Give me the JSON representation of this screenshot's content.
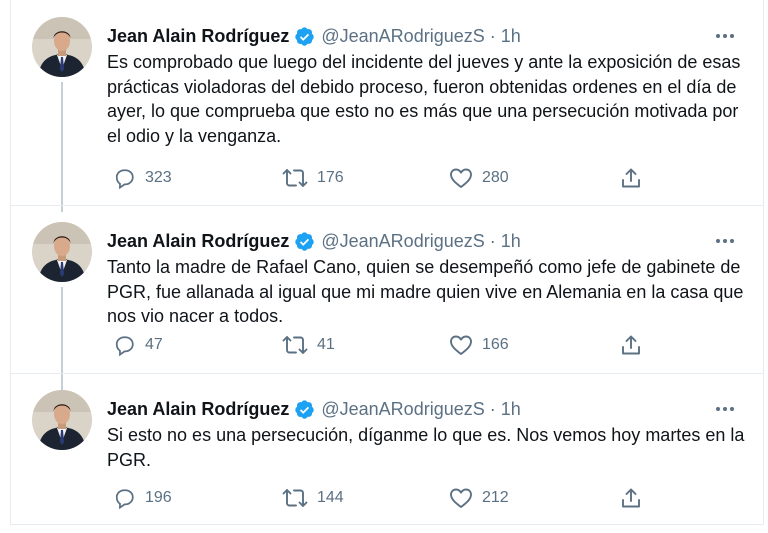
{
  "tweets": [
    {
      "author_name": "Jean Alain Rodríguez",
      "handle": "@JeanARodriguezS",
      "separator": "·",
      "time": "1h",
      "text": "Es comprobado que luego del incidente del jueves y ante la exposición de esas prácticas violadoras del debido proceso, fueron obtenidas ordenes en el día de ayer, lo que comprueba que esto no es más que una persecución motivada por el odio y la venganza.",
      "replies": "323",
      "retweets": "176",
      "likes": "280"
    },
    {
      "author_name": "Jean Alain Rodríguez",
      "handle": "@JeanARodriguezS",
      "separator": "·",
      "time": "1h",
      "text": "Tanto la madre de Rafael Cano, quien se desempeñó como jefe de gabinete de PGR, fue allanada al igual que mi madre quien vive en Alemania en la casa que nos vio nacer a todos.",
      "replies": "47",
      "retweets": "41",
      "likes": "166"
    },
    {
      "author_name": "Jean Alain Rodríguez",
      "handle": "@JeanARodriguezS",
      "separator": "·",
      "time": "1h",
      "text": "Si esto no es una persecución, díganme lo que es. Nos vemos hoy martes en la PGR.",
      "replies": "196",
      "retweets": "144",
      "likes": "212"
    }
  ],
  "icons": {
    "verified": "verified-badge-icon",
    "more": "more-options-icon",
    "reply": "reply-icon",
    "retweet": "retweet-icon",
    "like": "heart-icon",
    "share": "share-icon"
  },
  "colors": {
    "text": "#0f1419",
    "secondary": "#5b7083",
    "verified": "#1da1f2",
    "divider": "#e6ecf0",
    "thread_line": "#c4cfd6"
  }
}
